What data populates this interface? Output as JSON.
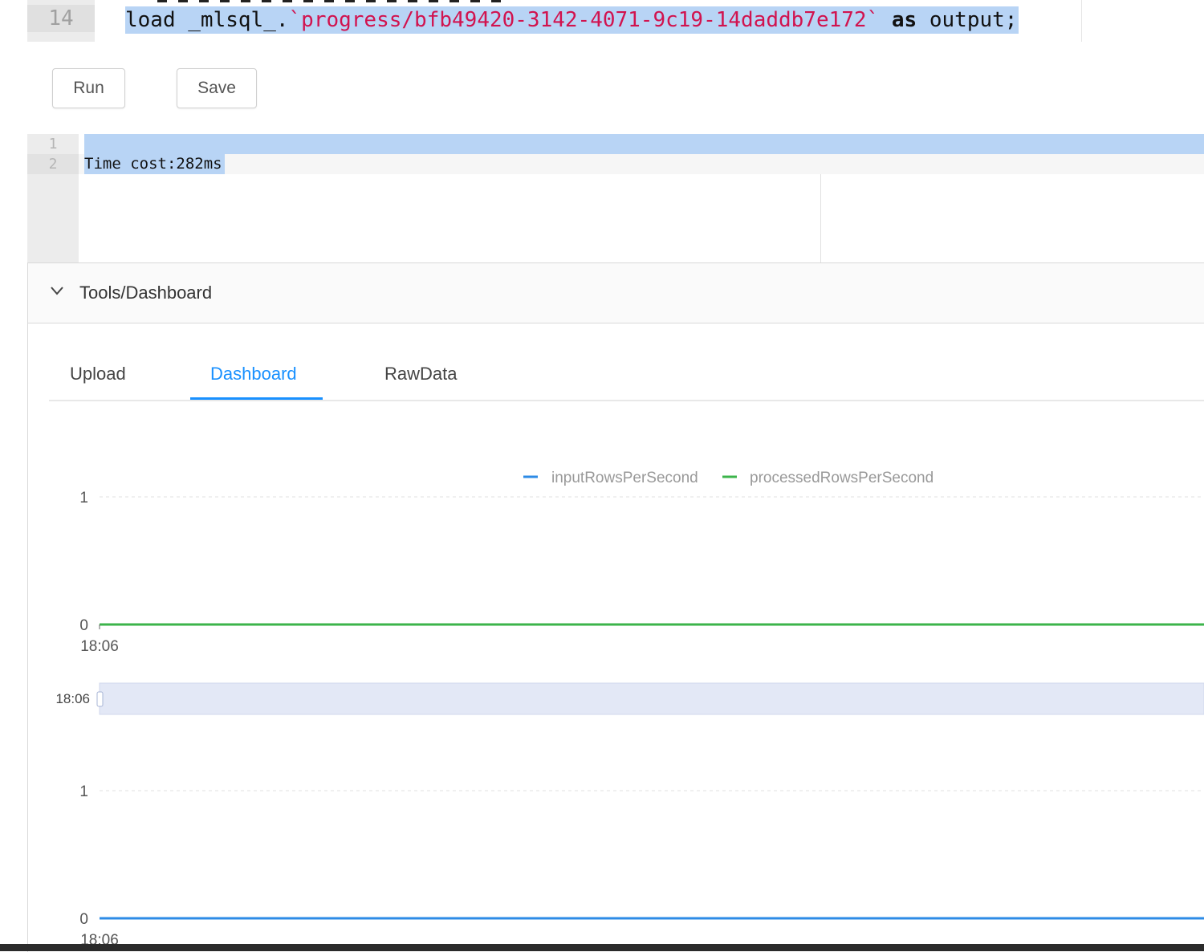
{
  "editor": {
    "line_number": "14",
    "code_load": "load",
    "code_source": "_mlsql_.",
    "code_path": "`progress/bfb49420-3142-4071-9c19-14daddb7e172`",
    "code_as": "as",
    "code_target": "output;"
  },
  "toolbar": {
    "run_label": "Run",
    "save_label": "Save"
  },
  "output": {
    "line1": "1",
    "line2": "2",
    "text": "Time cost:282ms"
  },
  "panel": {
    "title": "Tools/Dashboard",
    "tabs": [
      "Upload",
      "Dashboard",
      "RawData"
    ],
    "active_tab": "Dashboard"
  },
  "chart_data": [
    {
      "type": "line",
      "x": [
        "18:06"
      ],
      "series": [
        {
          "name": "inputRowsPerSecond",
          "values": [
            0
          ],
          "color": "#2d8be6"
        },
        {
          "name": "processedRowsPerSecond",
          "values": [
            0
          ],
          "color": "#3cb44b"
        }
      ],
      "yticks": [
        "0",
        "1"
      ],
      "ylim": [
        0,
        1
      ],
      "xtick": "18:06",
      "legend": "top-center",
      "slider_label": "18:06"
    },
    {
      "type": "line",
      "x": [
        "18:06"
      ],
      "series": [
        {
          "values": [
            0
          ],
          "color": "#2d8be6"
        }
      ],
      "yticks": [
        "0",
        "1"
      ],
      "ylim": [
        0,
        1
      ],
      "xtick": "18:06"
    }
  ]
}
